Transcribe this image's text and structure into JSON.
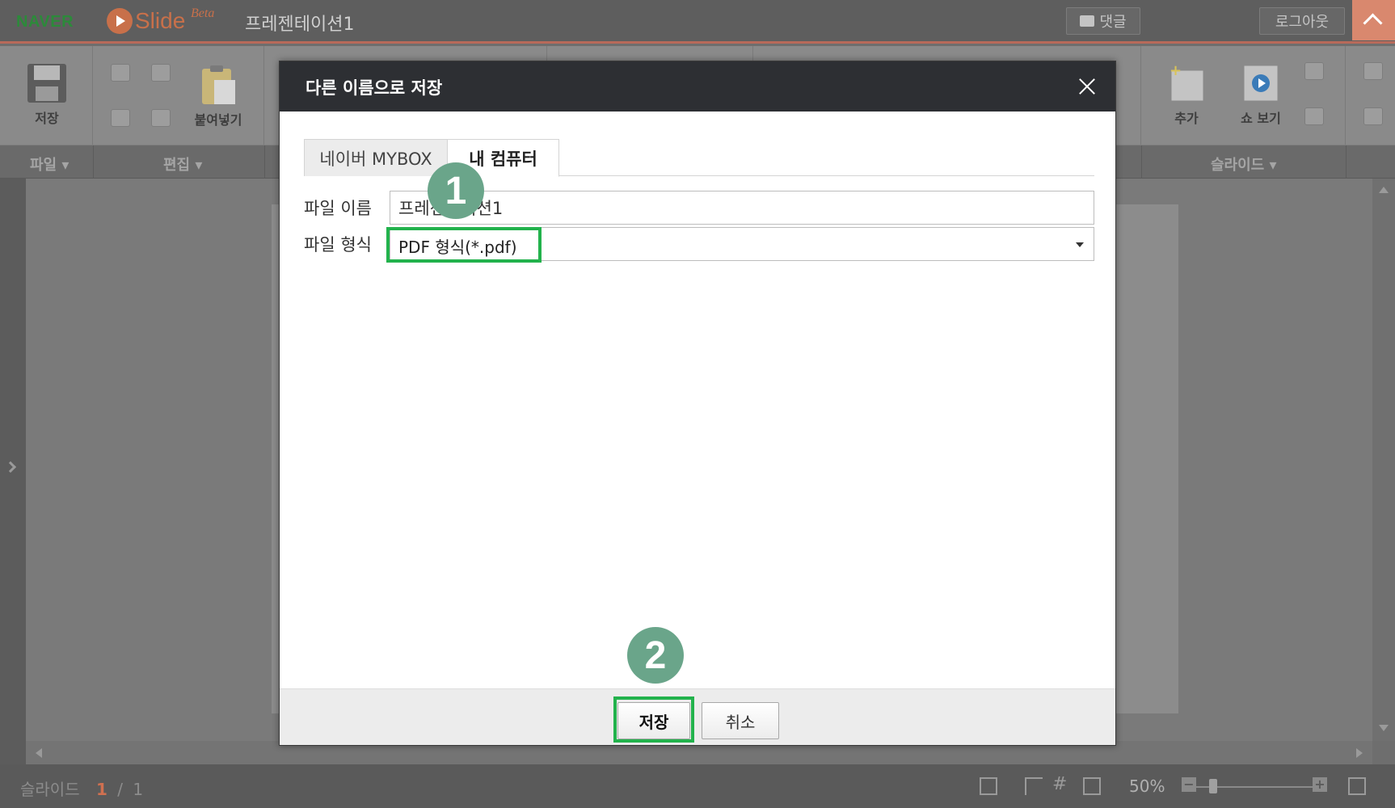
{
  "topbar": {
    "naver_logo": "NAVER",
    "slide_logo": "Slide",
    "beta": "Beta",
    "doc_title": "프레젠테이션1",
    "comment_label": "댓글",
    "logout_label": "로그아웃"
  },
  "ribbon": {
    "save_label": "저장",
    "paste_label": "붙여넣기",
    "add_label": "추가",
    "show_label": "쇼 보기",
    "groups": {
      "file": "파일",
      "edit": "편집",
      "slide": "슬라이드"
    }
  },
  "dialog": {
    "title": "다른 이름으로 저장",
    "tabs": [
      {
        "label": "네이버 MYBOX",
        "active": false
      },
      {
        "label": "내 컴퓨터",
        "active": true
      }
    ],
    "file_name_label": "파일 이름",
    "file_name_value": "프레젠테이션1",
    "file_format_label": "파일 형식",
    "file_format_value": "PDF 형식(*.pdf)",
    "save_button": "저장",
    "cancel_button": "취소"
  },
  "annotations": {
    "step1": "1",
    "step2": "2",
    "highlight_color": "#22b24c",
    "badge_color": "#6aa58a"
  },
  "statusbar": {
    "slide_label": "슬라이드",
    "current_slide": "1",
    "separator": "/",
    "total_slides": "1",
    "zoom": "50%"
  },
  "colors": {
    "header_dark": "#2d2f33",
    "accent": "#d9886e"
  }
}
